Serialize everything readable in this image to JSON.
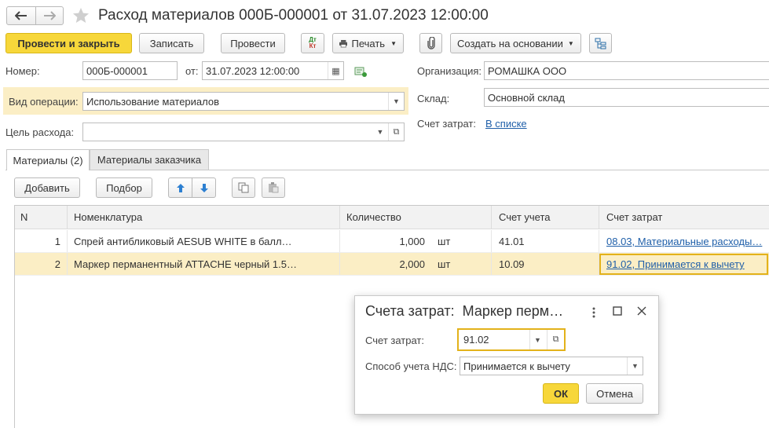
{
  "window": {
    "title": "Расход материалов 000Б-000001 от 31.07.2023 12:00:00"
  },
  "toolbar": {
    "post_close": "Провести и закрыть",
    "save": "Записать",
    "post": "Провести",
    "dt_kt": "Дт Кт",
    "print": "Печать",
    "create_based": "Создать на основании"
  },
  "form": {
    "number_label": "Номер:",
    "number_value": "000Б-000001",
    "date_label": "от:",
    "date_value": "31.07.2023 12:00:00",
    "org_label": "Организация:",
    "org_value": "РОМАШКА ООО",
    "op_label": "Вид операции:",
    "op_value": "Использование материалов",
    "warehouse_label": "Склад:",
    "warehouse_value": "Основной склад",
    "purpose_label": "Цель расхода:",
    "purpose_value": "",
    "cost_acc_label": "Счет затрат:",
    "cost_acc_link": "В списке"
  },
  "tabs": [
    {
      "label": "Материалы (2)",
      "active": true
    },
    {
      "label": "Материалы заказчика",
      "active": false
    }
  ],
  "table_toolbar": {
    "add": "Добавить",
    "pick": "Подбор"
  },
  "table": {
    "headers": [
      "N",
      "Номенклатура",
      "Количество",
      "Счет учета",
      "Счет затрат"
    ],
    "rows": [
      {
        "n": "1",
        "item": "Спрей антибликовый AESUB WHITE в балл…",
        "qty": "1,000",
        "unit": "шт",
        "account": "41.01",
        "cost_account": "08.03, Материальные расходы…"
      },
      {
        "n": "2",
        "item": "Маркер перманентный ATTACHE черный 1.5…",
        "qty": "2,000",
        "unit": "шт",
        "account": "10.09",
        "cost_account": "91.02, Принимается к вычету"
      }
    ]
  },
  "dialog": {
    "title": "Счета затрат:  Маркер перм…",
    "cost_label": "Счет затрат:",
    "cost_value": "91.02",
    "vat_label": "Способ учета НДС:",
    "vat_value": "Принимается к вычету",
    "ok": "ОК",
    "cancel": "Отмена"
  },
  "colors": {
    "primary_button": "#f7d73a",
    "selected_row": "#fbeec5",
    "focus_border": "#e3b21a",
    "link": "#1f5fa9"
  }
}
